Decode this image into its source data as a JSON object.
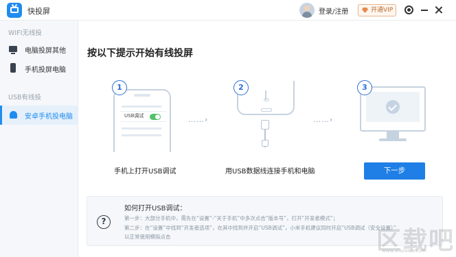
{
  "app": {
    "name": "快投屏"
  },
  "header": {
    "login_label": "登录/注册",
    "vip_label": "开通VIP"
  },
  "sidebar": {
    "sections": [
      {
        "title": "WIFI无线投",
        "items": [
          {
            "label": "电脑投屏其他",
            "icon": "monitor-icon"
          },
          {
            "label": "手机投屏电脑",
            "icon": "phone-icon"
          }
        ]
      },
      {
        "title": "USB有线投",
        "items": [
          {
            "label": "安卓手机投电脑",
            "icon": "android-icon",
            "active": true
          }
        ]
      }
    ]
  },
  "main": {
    "title": "按以下提示开始有线投屏",
    "steps": [
      {
        "num": "1",
        "caption": "手机上打开USB调试",
        "inner_label": "USB调试"
      },
      {
        "num": "2",
        "caption": "用USB数据线连接手机和电脑"
      },
      {
        "num": "3",
        "caption": ""
      }
    ],
    "arrow": "……›",
    "next_label": "下一步"
  },
  "help": {
    "icon": "?",
    "title": "如何打开USB调试：",
    "lines": [
      "第一步：大部分手机中，需先在“设置”-“关于手机”中多次点击“版本号”，打开“开发者模式”；",
      "第二步：在“设置”中找到“开发者选项”，在其中找到并开启“USB调试”，小米手机建议同时开启“USB调试（安全设置）”",
      "以正常使用模拟点击"
    ]
  },
  "watermark": {
    "main": "区载吧",
    "sub": "www.xiazaiba.com"
  },
  "colors": {
    "accent": "#1f7fe6",
    "toggle": "#4fc36c",
    "sidebar_bg": "#f5f7fa"
  }
}
